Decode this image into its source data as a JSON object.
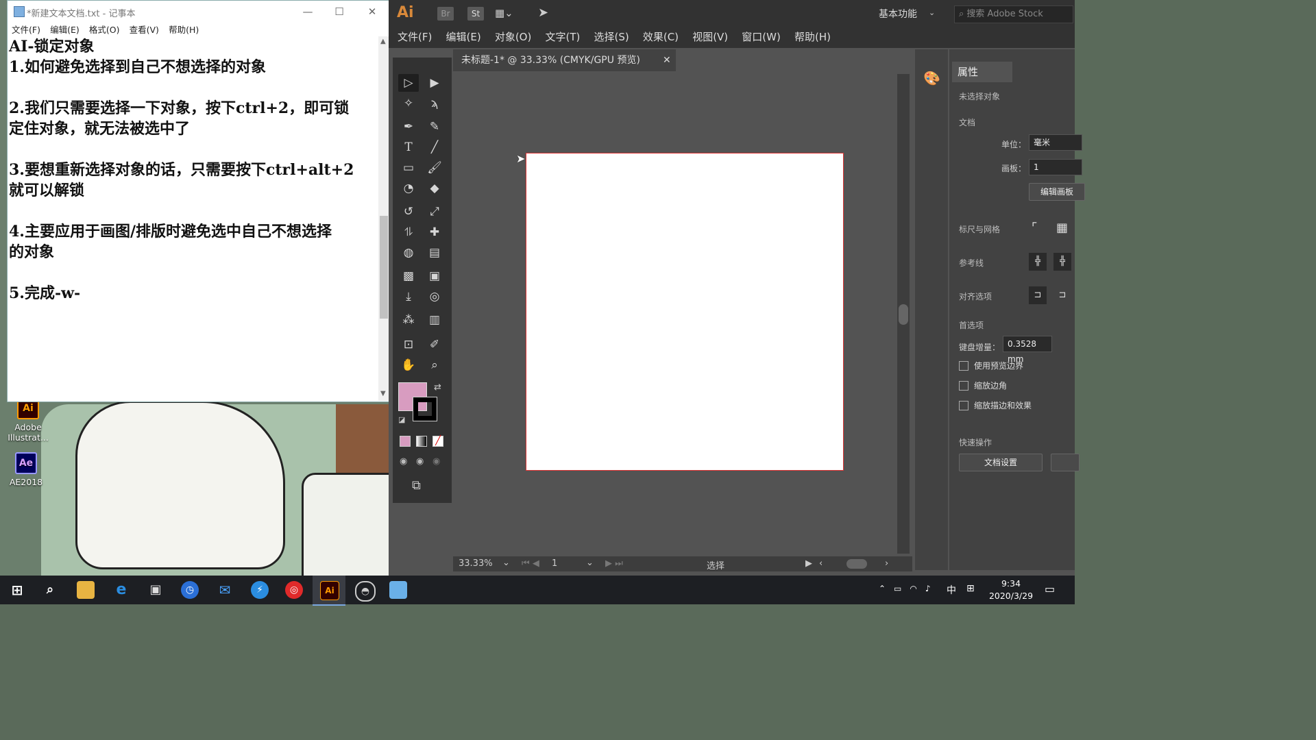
{
  "notepad": {
    "title": "*新建文本文档.txt - 记事本",
    "menu": [
      "文件(F)",
      "编辑(E)",
      "格式(O)",
      "查看(V)",
      "帮助(H)"
    ],
    "content": "AI-锁定对象\n1.如何避免选择到自己不想选择的对象\n\n2.我们只需要选择一下对象，按下ctrl+2，即可锁\n定住对象，就无法被选中了\n\n3.要想重新选择对象的话，只需要按下ctrl+alt+2\n就可以解锁\n\n4.主要应用于画图/排版时避免选中自己不想选择\n的对象\n\n5.完成-w-"
  },
  "desktop_icons": [
    {
      "label": "Adobe Illustrat...",
      "glyph": "Ai",
      "icon": "illustrator-icon"
    },
    {
      "label": "AE2018",
      "glyph": "Ae",
      "icon": "after-effects-icon"
    }
  ],
  "illustrator": {
    "logo": "Ai",
    "top_buttons": [
      "Br",
      "St"
    ],
    "workspace": "基本功能",
    "search_placeholder": "搜索 Adobe Stock",
    "menu": [
      "文件(F)",
      "编辑(E)",
      "对象(O)",
      "文字(T)",
      "选择(S)",
      "效果(C)",
      "视图(V)",
      "窗口(W)",
      "帮助(H)"
    ],
    "doc_tab": "未标题-1* @ 33.33% (CMYK/GPU 预览)",
    "status": {
      "zoom": "33.33%",
      "artboard": "1",
      "tool": "选择"
    },
    "fill_color": "#d89cc0",
    "stroke_color": "#000000",
    "properties": {
      "tab": "属性",
      "no_selection": "未选择对象",
      "document": "文档",
      "unit_label": "单位：",
      "unit_value": "毫米",
      "artboard_label": "画板：",
      "artboard_value": "1",
      "edit_artboard": "编辑画板",
      "rulers_grids": "标尺与网格",
      "guides": "参考线",
      "align_options": "对齐选项",
      "preferences": "首选项",
      "keyboard_inc_label": "键盘增量：",
      "keyboard_inc_value": "0.3528 mm",
      "checkboxes": [
        "使用预览边界",
        "缩放边角",
        "缩放描边和效果"
      ],
      "quick_actions": "快速操作",
      "doc_settings": "文档设置"
    }
  },
  "taskbar": {
    "time": "9:34",
    "date": "2020/3/29",
    "ime": "中"
  }
}
